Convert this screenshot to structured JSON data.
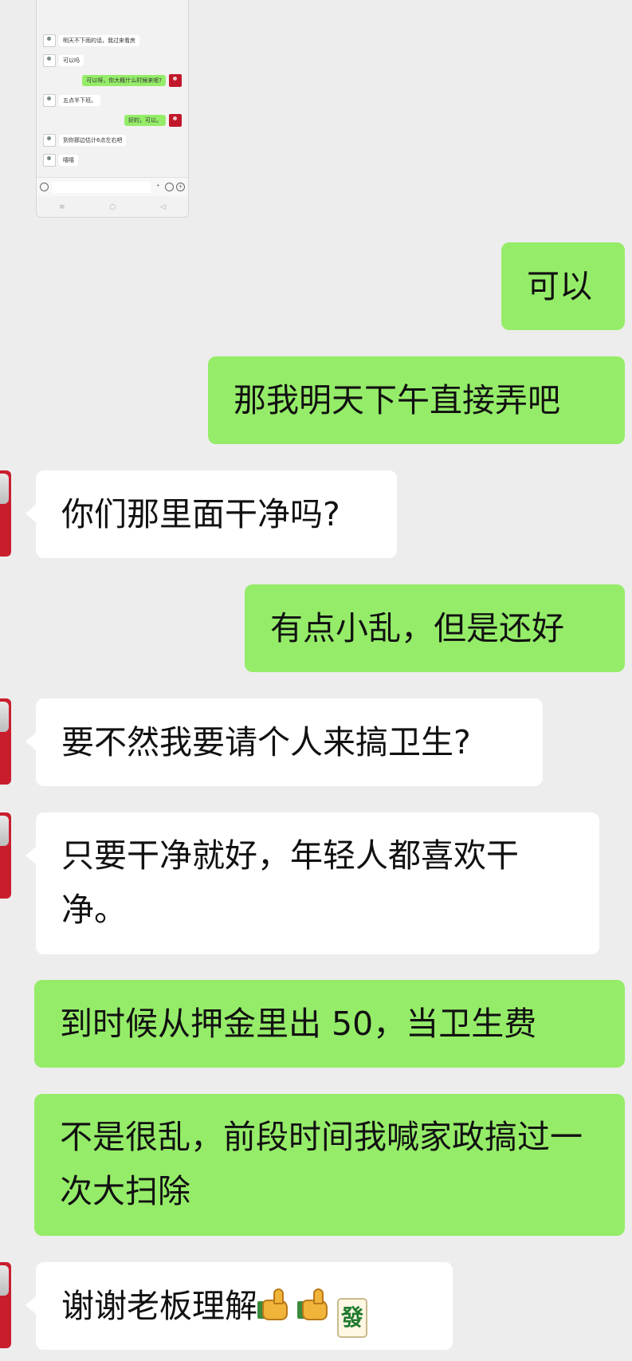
{
  "thumbnail": {
    "messages": [
      {
        "side": "left",
        "avatar": "avatar-man",
        "text": "明天不下雨的话，我过来看房"
      },
      {
        "side": "left",
        "avatar": "avatar-man",
        "text": "可以吗"
      },
      {
        "side": "right",
        "avatar": "avatar-red",
        "text": "可以呀，你大概什么时候来呢?"
      },
      {
        "side": "left",
        "avatar": "avatar-man",
        "text": "五点半下班。"
      },
      {
        "side": "right",
        "avatar": "avatar-red",
        "text": "好的，可以。"
      },
      {
        "side": "left",
        "avatar": "avatar-man",
        "text": "到你那边估计6点左右吧"
      },
      {
        "side": "left",
        "avatar": "avatar-man",
        "text": "嘻嘻"
      }
    ],
    "input_icons": [
      "voice-icon",
      "mic-icon",
      "emoji-icon",
      "plus-icon"
    ],
    "nav_icons": {
      "menu": "≡",
      "home": "○",
      "back": "◁"
    }
  },
  "chat": {
    "messages": [
      {
        "id": "m1",
        "side": "me",
        "text": "可以"
      },
      {
        "id": "m2",
        "side": "me",
        "text": "那我明天下午直接弄吧"
      },
      {
        "id": "m3",
        "side": "them",
        "text": "你们那里面干净吗?"
      },
      {
        "id": "m4",
        "side": "me",
        "text": "有点小乱，但是还好"
      },
      {
        "id": "m5",
        "side": "them",
        "text": "要不然我要请个人来搞卫生?"
      },
      {
        "id": "m6",
        "side": "them",
        "text": "只要干净就好，年轻人都喜欢干净。"
      },
      {
        "id": "m7",
        "side": "me",
        "text": "到时候从押金里出 50，当卫生费"
      },
      {
        "id": "m8",
        "side": "me",
        "text": "不是很乱，前段时间我喊家政搞过一次大扫除"
      },
      {
        "id": "m9",
        "side": "them",
        "text": "谢谢老板理解",
        "emojis": [
          "thumbs-up-emoji",
          "thumbs-up-emoji",
          "mahjong-fa-emoji"
        ]
      }
    ]
  },
  "emoji_glyphs": {
    "mahjong": "發"
  },
  "colors": {
    "my_bubble": "#95ec69",
    "their_bubble": "#ffffff",
    "background": "#ededed"
  }
}
